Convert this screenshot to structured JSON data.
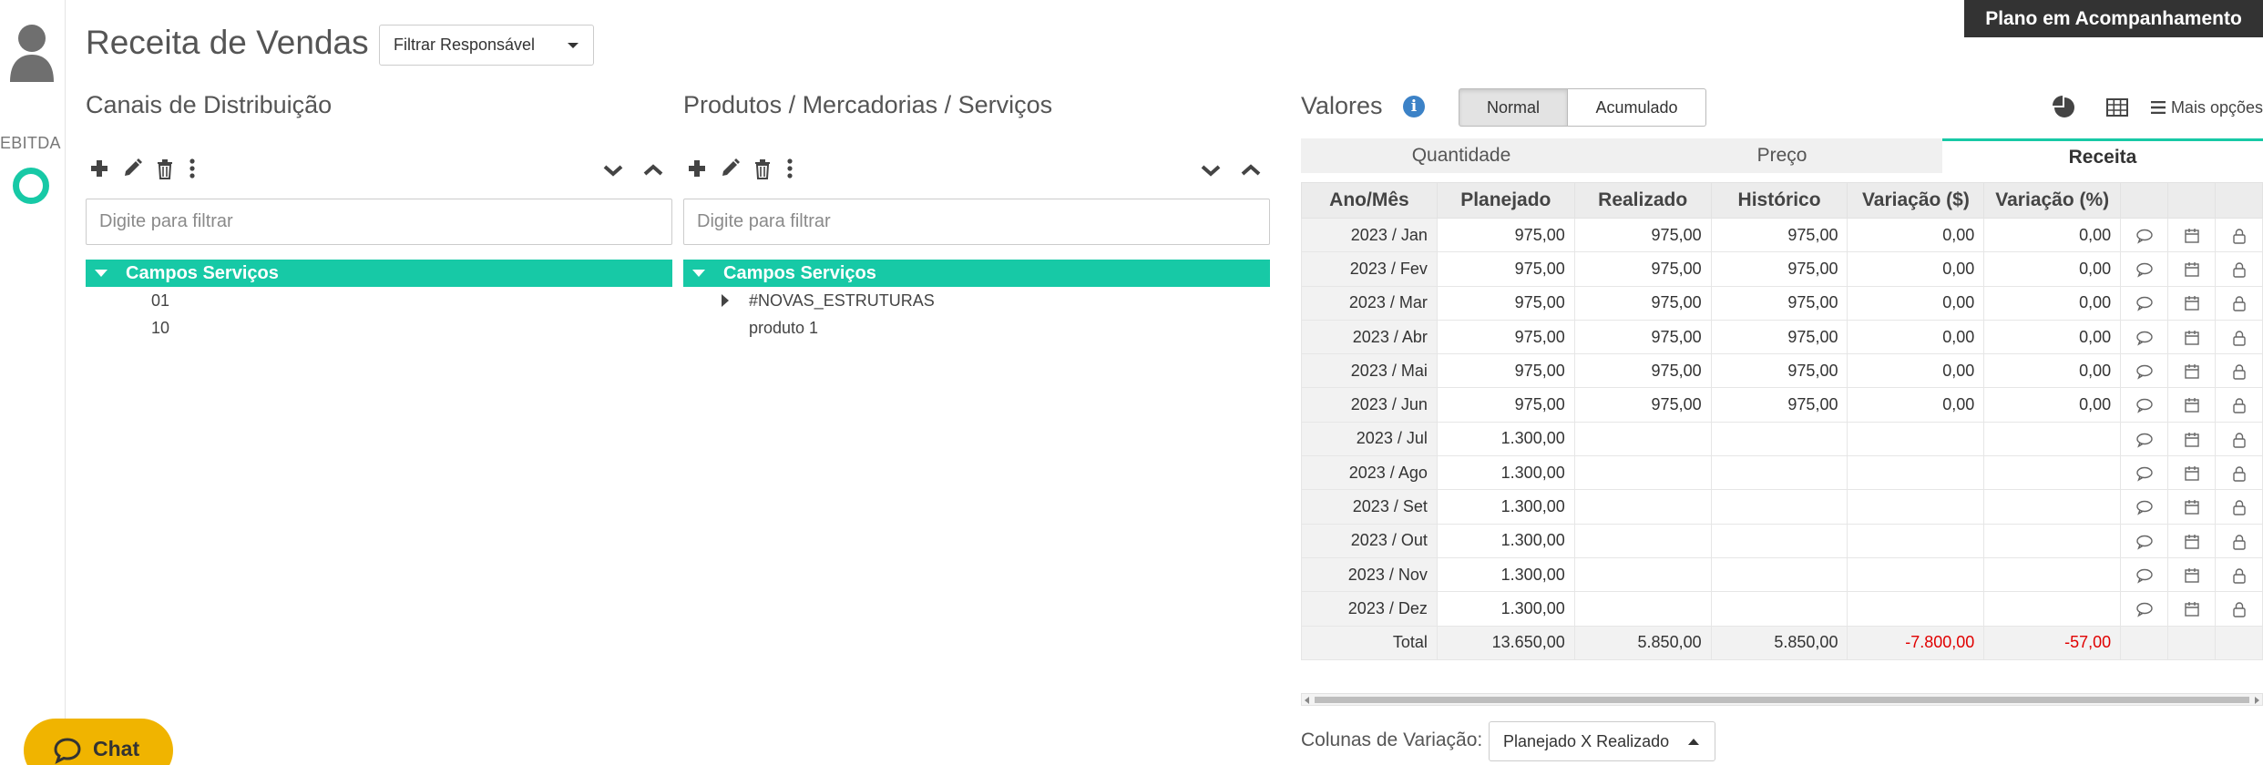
{
  "rail": {
    "label": "EBITDA",
    "icons": [
      "user-avatar-icon",
      "ring-icon"
    ]
  },
  "chat": {
    "label": "Chat",
    "icon": "chat-bubble-icon",
    "color": "#f0b400"
  },
  "header": {
    "title": "Receita de Vendas",
    "filter_label": "Filtrar Responsável",
    "plan_badge": "Plano em Acompanhamento"
  },
  "accent_color": "#17c9a6",
  "channels": {
    "title": "Canais de Distribuição",
    "filter_placeholder": "Digite para filtrar",
    "root": "Campos Serviços",
    "children": [
      "01",
      "10"
    ]
  },
  "products": {
    "title": "Produtos / Mercadorias / Serviços",
    "filter_placeholder": "Digite para filtrar",
    "root": "Campos Serviços",
    "children": [
      "#NOVAS_ESTRUTURAS",
      "produto 1"
    ]
  },
  "values": {
    "title": "Valores",
    "modes": [
      "Normal",
      "Acumulado"
    ],
    "active_mode": "Normal",
    "more_options": "Mais opções",
    "tabs": [
      "Quantidade",
      "Preço",
      "Receita"
    ],
    "active_tab": "Receita",
    "columns": [
      "Ano/Mês",
      "Planejado",
      "Realizado",
      "Histórico",
      "Variação ($)",
      "Variação (%)"
    ],
    "rows": [
      [
        "2023 / Jan",
        "975,00",
        "975,00",
        "975,00",
        "0,00",
        "0,00"
      ],
      [
        "2023 / Fev",
        "975,00",
        "975,00",
        "975,00",
        "0,00",
        "0,00"
      ],
      [
        "2023 / Mar",
        "975,00",
        "975,00",
        "975,00",
        "0,00",
        "0,00"
      ],
      [
        "2023 / Abr",
        "975,00",
        "975,00",
        "975,00",
        "0,00",
        "0,00"
      ],
      [
        "2023 / Mai",
        "975,00",
        "975,00",
        "975,00",
        "0,00",
        "0,00"
      ],
      [
        "2023 / Jun",
        "975,00",
        "975,00",
        "975,00",
        "0,00",
        "0,00"
      ],
      [
        "2023 / Jul",
        "1.300,00",
        "",
        "",
        "",
        ""
      ],
      [
        "2023 / Ago",
        "1.300,00",
        "",
        "",
        "",
        ""
      ],
      [
        "2023 / Set",
        "1.300,00",
        "",
        "",
        "",
        ""
      ],
      [
        "2023 / Out",
        "1.300,00",
        "",
        "",
        "",
        ""
      ],
      [
        "2023 / Nov",
        "1.300,00",
        "",
        "",
        "",
        ""
      ],
      [
        "2023 / Dez",
        "1.300,00",
        "",
        "",
        "",
        ""
      ]
    ],
    "total": [
      "Total",
      "13.650,00",
      "5.850,00",
      "5.850,00",
      "-7.800,00",
      "-57,00"
    ],
    "negative_color": "#e00000",
    "row_icons": [
      "comment-icon",
      "calendar-icon",
      "lock-icon"
    ]
  },
  "variation": {
    "label": "Colunas de Variação:",
    "selected": "Planejado X Realizado"
  }
}
